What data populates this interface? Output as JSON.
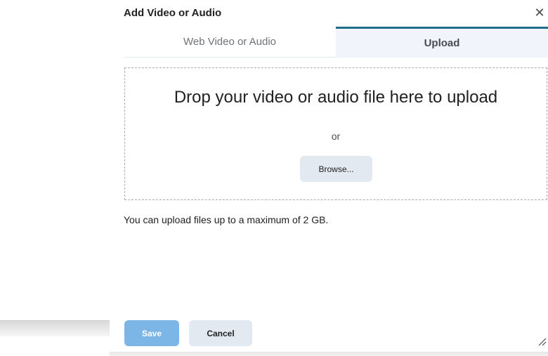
{
  "dialog": {
    "title": "Add Video or Audio",
    "close_icon": "close-icon",
    "tabs": [
      {
        "label": "Web Video or Audio",
        "active": false
      },
      {
        "label": "Upload",
        "active": true
      }
    ],
    "dropzone": {
      "heading": "Drop your video or audio file here to upload",
      "or_text": "or",
      "browse_label": "Browse..."
    },
    "limit_text": "You can upload files up to a maximum of 2 GB.",
    "footer": {
      "save_label": "Save",
      "cancel_label": "Cancel"
    }
  },
  "colors": {
    "active_tab_accent": "#1e6e8c",
    "primary_button": "#7cb6e6",
    "secondary_button": "#e3e9f1"
  }
}
